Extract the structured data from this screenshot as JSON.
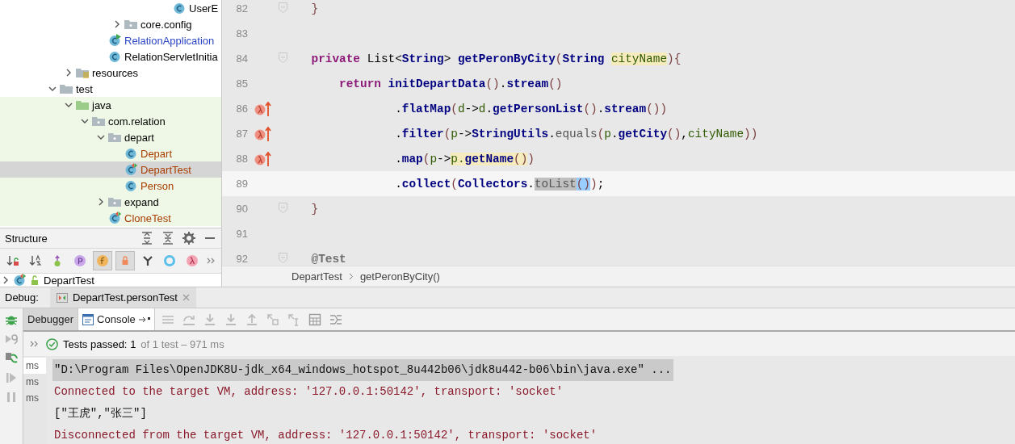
{
  "project_tree": {
    "items": [
      {
        "children": [
          {
            "children": [
              {
                "children": [
                  {
                    "children": [
                      {
                        "children": [
                          {
                            "children": [
                              {
                                "children": [
                                  {
                                    "label": "UserE",
                                    "kind": "class",
                                    "color": "#000000",
                                    "test_scope": false,
                                    "selected": false
                                  }
                                ]
                              }
                            ]
                          }
                        ]
                      },
                      {
                        "label": "core.config",
                        "kind": "package",
                        "color": "#000000",
                        "test_scope": false,
                        "selected": false,
                        "expanded": false
                      }
                    ]
                  },
                  {
                    "label": "RelationApplication",
                    "kind": "spring-app",
                    "color": "#2b44c4",
                    "test_scope": false,
                    "selected": false
                  },
                  {
                    "label": "RelationServletInitia",
                    "kind": "class",
                    "color": "#000000",
                    "test_scope": false,
                    "selected": false
                  }
                ]
              }
            ]
          },
          {
            "label": "resources",
            "kind": "resources",
            "color": "#000000",
            "test_scope": false,
            "selected": false,
            "expanded": false
          }
        ]
      },
      {
        "label": "test",
        "kind": "folder",
        "color": "#000000",
        "test_scope": false,
        "selected": false,
        "expanded": true,
        "children": [
          {
            "label": "java",
            "kind": "test-root",
            "color": "#000000",
            "test_scope": true,
            "selected": false,
            "expanded": true,
            "children": [
              {
                "label": "com.relation",
                "kind": "package",
                "color": "#000000",
                "test_scope": true,
                "selected": false,
                "expanded": true,
                "children": [
                  {
                    "label": "depart",
                    "kind": "package",
                    "color": "#000000",
                    "test_scope": true,
                    "selected": false,
                    "expanded": true,
                    "children": [
                      {
                        "label": "Depart",
                        "kind": "class",
                        "color": "#a83d00",
                        "test_scope": true,
                        "selected": false
                      },
                      {
                        "label": "DepartTest",
                        "kind": "test-class",
                        "color": "#a83d00",
                        "test_scope": true,
                        "selected": true
                      },
                      {
                        "label": "Person",
                        "kind": "class",
                        "color": "#a83d00",
                        "test_scope": true,
                        "selected": false
                      }
                    ]
                  },
                  {
                    "label": "expand",
                    "kind": "package",
                    "color": "#000000",
                    "test_scope": true,
                    "selected": false,
                    "expanded": false
                  },
                  {
                    "label": "CloneTest",
                    "kind": "test-class",
                    "color": "#a83d00",
                    "test_scope": true,
                    "selected": false
                  }
                ]
              }
            ]
          }
        ]
      }
    ]
  },
  "structure": {
    "title": "Structure",
    "toolbar": [
      {
        "kind": "sort-visibility",
        "on": false
      },
      {
        "kind": "sort-alpha",
        "on": false
      },
      {
        "kind": "inherited",
        "on": false
      },
      {
        "kind": "property",
        "on": false
      },
      {
        "kind": "field",
        "on": true
      },
      {
        "kind": "lock",
        "on": true
      },
      {
        "kind": "fork",
        "on": false
      },
      {
        "kind": "ring",
        "on": false
      },
      {
        "kind": "lambda",
        "on": false
      }
    ],
    "rows": [
      {
        "label": "DepartTest",
        "expanded": false
      }
    ]
  },
  "editor": {
    "lines": [
      {
        "number": "82",
        "lambda": false,
        "fold": true,
        "current": false,
        "tokens": [
          {
            "text": "    }",
            "kind": "paren"
          }
        ]
      },
      {
        "number": "83",
        "lambda": false,
        "fold": false,
        "current": false
      },
      {
        "number": "84",
        "lambda": false,
        "fold": true,
        "current": false,
        "tokens": [
          {
            "text": "    private",
            "kind": "keyword"
          },
          {
            "text": " List<"
          },
          {
            "text": "String",
            "kind": "bold"
          },
          {
            "text": "> "
          },
          {
            "text": "getPeronByCity",
            "kind": "bold"
          },
          {
            "text": "(",
            "kind": "paren"
          },
          {
            "text": "String ",
            "kind": "bold"
          },
          {
            "text": "cityName",
            "kind": "usage-param"
          },
          {
            "text": "){",
            "kind": "paren"
          }
        ]
      },
      {
        "number": "85",
        "lambda": false,
        "fold": false,
        "current": false,
        "tokens": [
          {
            "text": "        return ",
            "kind": "keyword"
          },
          {
            "text": "initDepartData",
            "kind": "bold"
          },
          {
            "text": "()",
            "kind": "paren"
          },
          {
            "text": "."
          },
          {
            "text": "stream",
            "kind": "bold"
          },
          {
            "text": "()",
            "kind": "paren"
          }
        ]
      },
      {
        "number": "86",
        "lambda": true,
        "fold": false,
        "current": false,
        "tokens": [
          {
            "text": "                ."
          },
          {
            "text": "flatMap",
            "kind": "bold"
          },
          {
            "text": "(",
            "kind": "paren"
          },
          {
            "text": "d",
            "kind": "param"
          },
          {
            "text": "->"
          },
          {
            "text": "d",
            "kind": "param"
          },
          {
            "text": "."
          },
          {
            "text": "getPersonList",
            "kind": "bold"
          },
          {
            "text": "()",
            "kind": "paren"
          },
          {
            "text": "."
          },
          {
            "text": "stream",
            "kind": "bold"
          },
          {
            "text": "())",
            "kind": "paren"
          }
        ]
      },
      {
        "number": "87",
        "lambda": true,
        "fold": false,
        "current": false,
        "tokens": [
          {
            "text": "                ."
          },
          {
            "text": "filter",
            "kind": "bold"
          },
          {
            "text": "(",
            "kind": "paren"
          },
          {
            "text": "p",
            "kind": "param"
          },
          {
            "text": "->"
          },
          {
            "text": "StringUtils",
            "kind": "bold"
          },
          {
            "text": "."
          },
          {
            "text": "equals",
            "kind": "dim"
          },
          {
            "text": "(",
            "kind": "paren"
          },
          {
            "text": "p",
            "kind": "param"
          },
          {
            "text": "."
          },
          {
            "text": "getCity",
            "kind": "bold"
          },
          {
            "text": "()",
            "kind": "paren"
          },
          {
            "text": ","
          },
          {
            "text": "cityName",
            "kind": "param"
          },
          {
            "text": "))",
            "kind": "paren"
          }
        ]
      },
      {
        "number": "88",
        "lambda": true,
        "fold": false,
        "current": false,
        "tokens": [
          {
            "text": "                ."
          },
          {
            "text": "map",
            "kind": "bold"
          },
          {
            "text": "(",
            "kind": "paren"
          },
          {
            "text": "p",
            "kind": "param"
          },
          {
            "text": "->"
          },
          {
            "text": "p.",
            "kind": "usage-param"
          },
          {
            "text": "getName",
            "kind": "usage-bold"
          },
          {
            "text": "()",
            "kind": "usage-paren"
          },
          {
            "text": ")",
            "kind": "paren"
          }
        ]
      },
      {
        "number": "89",
        "lambda": false,
        "fold": false,
        "current": true,
        "tokens": [
          {
            "text": "                ."
          },
          {
            "text": "collect",
            "kind": "bold"
          },
          {
            "text": "(",
            "kind": "paren"
          },
          {
            "text": "Collectors",
            "kind": "bold"
          },
          {
            "text": "."
          },
          {
            "text": "toList",
            "kind": "selected-dim"
          },
          {
            "text": "()",
            "kind": "matched-paren"
          },
          {
            "text": ")",
            "kind": "paren"
          },
          {
            "text": ";"
          }
        ]
      },
      {
        "number": "90",
        "lambda": false,
        "fold": true,
        "current": false,
        "tokens": [
          {
            "text": "    }",
            "kind": "paren"
          }
        ]
      },
      {
        "number": "91",
        "lambda": false,
        "fold": false,
        "current": false
      },
      {
        "number": "92",
        "lambda": false,
        "fold": true,
        "current": false,
        "tokens": [
          {
            "text": "    @Test",
            "kind": "annotation"
          }
        ]
      }
    ],
    "breadcrumb": [
      "DepartTest",
      "getPeronByCity()"
    ]
  },
  "debug": {
    "label": "Debug:",
    "session_tab": "DepartTest.personTest",
    "tabs": [
      {
        "label": "Debugger",
        "selected": false
      },
      {
        "label": "Console",
        "selected": true
      }
    ],
    "test_status": {
      "title": "Tests passed:",
      "count": "1",
      "detail": "of 1 test – 971 ms"
    },
    "test_items": [
      {
        "label": "ms",
        "selected": true
      },
      {
        "label": "ms",
        "selected": false
      },
      {
        "label": "ms",
        "selected": false
      }
    ],
    "console": [
      {
        "kind": "command",
        "text": "\"D:\\Program Files\\OpenJDK8U-jdk_x64_windows_hotspot_8u442b06\\jdk8u442-b06\\bin\\java.exe\" ..."
      },
      {
        "kind": "system",
        "text": "Connected to the target VM, address: '127.0.0.1:50142', transport: 'socket'"
      },
      {
        "kind": "output",
        "text": "[\"王虎\",\"张三\"]"
      },
      {
        "kind": "system",
        "text": "Disconnected from the target VM, address: '127.0.0.1:50142', transport: 'socket'"
      }
    ]
  }
}
